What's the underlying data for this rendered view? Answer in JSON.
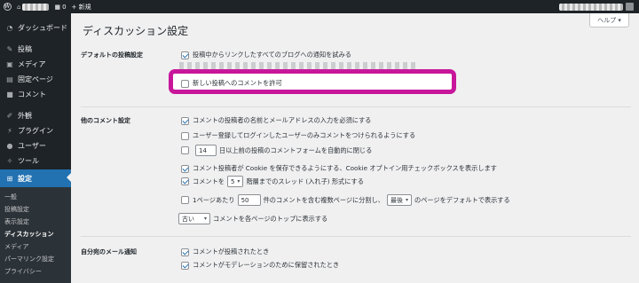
{
  "adminbar": {
    "comments_count": "0",
    "new_label": "+ 新規"
  },
  "sidebar": {
    "items": [
      {
        "label": "ダッシュボード",
        "icon": "dashboard-icon"
      },
      {
        "label": "投稿",
        "icon": "pin-icon"
      },
      {
        "label": "メディア",
        "icon": "media-icon"
      },
      {
        "label": "固定ページ",
        "icon": "page-icon"
      },
      {
        "label": "コメント",
        "icon": "comment-icon"
      },
      {
        "label": "外観",
        "icon": "brush-icon"
      },
      {
        "label": "プラグイン",
        "icon": "plugin-icon"
      },
      {
        "label": "ユーザー",
        "icon": "user-icon"
      },
      {
        "label": "ツール",
        "icon": "wrench-icon"
      },
      {
        "label": "設定",
        "icon": "settings-icon"
      }
    ],
    "submenu": [
      "一般",
      "投稿設定",
      "表示設定",
      "ディスカッション",
      "メディア",
      "パーマリンク設定",
      "プライバシー"
    ]
  },
  "help_label": "ヘルプ ▾",
  "page_title": "ディスカッション設定",
  "sections": {
    "default": {
      "label": "デフォルトの投稿設定",
      "opt_notify": "投稿中からリンクしたすべてのブログへの通知を試みる",
      "opt_allow_comments": "新しい投稿へのコメントを許可"
    },
    "other": {
      "label": "他のコメント設定",
      "opt_name_email": "コメントの投稿者の名前とメールアドレスの入力を必須にする",
      "opt_registered": "ユーザー登録してログインしたユーザーのみコメントをつけられるようにする",
      "close_days": "14",
      "opt_close_suffix": "日以上前の投稿のコメントフォームを自動的に閉じる",
      "opt_cookie": "コメント投稿者が Cookie を保存できるようにする、Cookie オプトイン用チェックボックスを表示します",
      "opt_thread_prefix": "コメントを",
      "thread_depth": "5",
      "opt_thread_suffix": "階層までのスレッド (入れ子) 形式にする",
      "opt_paging_prefix": "1ページあたり",
      "per_page": "50",
      "opt_paging_mid": "件のコメントを含む複数ページに分割し、",
      "default_page": "最後",
      "opt_paging_suffix": "のページをデフォルトで表示する",
      "order": "古い",
      "opt_order_suffix": "コメントを各ページのトップに表示する"
    },
    "email": {
      "label": "自分宛のメール通知",
      "opt_posted": "コメントが投稿されたとき",
      "opt_moderation": "コメントがモデレーションのために保留されたとき"
    }
  },
  "colors": {
    "highlight": "#c8169b",
    "accent": "#2271b1",
    "sidebar_bg": "#1d2327"
  }
}
